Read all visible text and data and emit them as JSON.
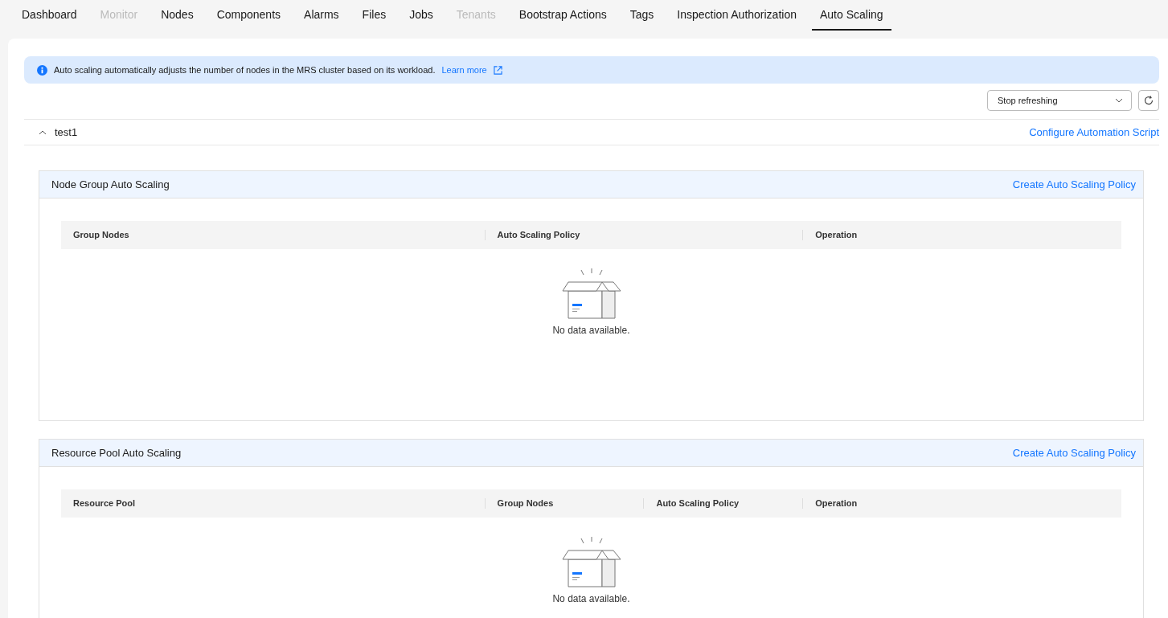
{
  "tabs": [
    {
      "label": "Dashboard",
      "selected": false,
      "disabled": false
    },
    {
      "label": "Monitor",
      "selected": false,
      "disabled": true
    },
    {
      "label": "Nodes",
      "selected": false,
      "disabled": false
    },
    {
      "label": "Components",
      "selected": false,
      "disabled": false
    },
    {
      "label": "Alarms",
      "selected": false,
      "disabled": false
    },
    {
      "label": "Files",
      "selected": false,
      "disabled": false
    },
    {
      "label": "Jobs",
      "selected": false,
      "disabled": false
    },
    {
      "label": "Tenants",
      "selected": false,
      "disabled": true
    },
    {
      "label": "Bootstrap Actions",
      "selected": false,
      "disabled": false
    },
    {
      "label": "Tags",
      "selected": false,
      "disabled": false
    },
    {
      "label": "Inspection Authorization",
      "selected": false,
      "disabled": false
    },
    {
      "label": "Auto Scaling",
      "selected": true,
      "disabled": false
    }
  ],
  "info_banner": {
    "text": "Auto scaling automatically adjusts the number of nodes in the MRS cluster based on its workload.",
    "link": "Learn more"
  },
  "refresh_select": {
    "value": "Stop refreshing"
  },
  "cluster": {
    "name": "test1",
    "expanded": true,
    "action": "Configure Automation Script"
  },
  "sections": [
    {
      "title": "Node Group Auto Scaling",
      "action": "Create Auto Scaling Policy",
      "columns": [
        "Group Nodes",
        "Auto Scaling Policy",
        "Operation"
      ],
      "empty_text": "No data available."
    },
    {
      "title": "Resource Pool Auto Scaling",
      "action": "Create Auto Scaling Policy",
      "columns": [
        "Resource Pool",
        "Group Nodes",
        "Auto Scaling Policy",
        "Operation"
      ],
      "empty_text": "No data available."
    }
  ]
}
